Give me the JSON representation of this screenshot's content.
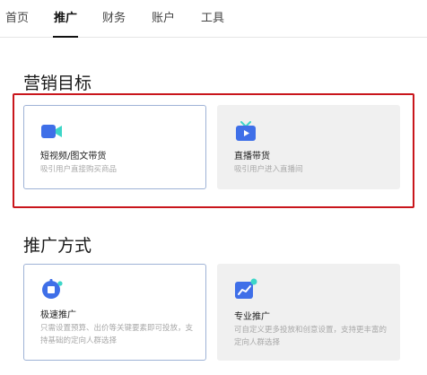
{
  "nav": {
    "tabs": [
      {
        "label": "首页",
        "active": false
      },
      {
        "label": "推广",
        "active": true
      },
      {
        "label": "财务",
        "active": false
      },
      {
        "label": "账户",
        "active": false
      },
      {
        "label": "工具",
        "active": false
      }
    ]
  },
  "marketing_goal": {
    "title": "营销目标",
    "cards": [
      {
        "title": "短视频/图文带货",
        "desc": "吸引用户直接购买商品",
        "icon": "video-camera-icon",
        "selected": true
      },
      {
        "title": "直播带货",
        "desc": "吸引用户进入直播间",
        "icon": "live-tv-icon",
        "selected": false
      }
    ]
  },
  "promotion_method": {
    "title": "推广方式",
    "cards": [
      {
        "title": "极速推广",
        "desc": "只需设置预算、出价等关键要素即可投放，支持基础的定向人群选择",
        "icon": "rocket-icon",
        "selected": true
      },
      {
        "title": "专业推广",
        "desc": "可自定义更多投放和创意设置，支持更丰富的定向人群选择",
        "icon": "trend-chart-icon",
        "selected": false
      }
    ]
  },
  "colors": {
    "accent_blue": "#3f6fe8",
    "highlight_red": "#c9161c",
    "icon_cyan": "#3dd6c8"
  }
}
